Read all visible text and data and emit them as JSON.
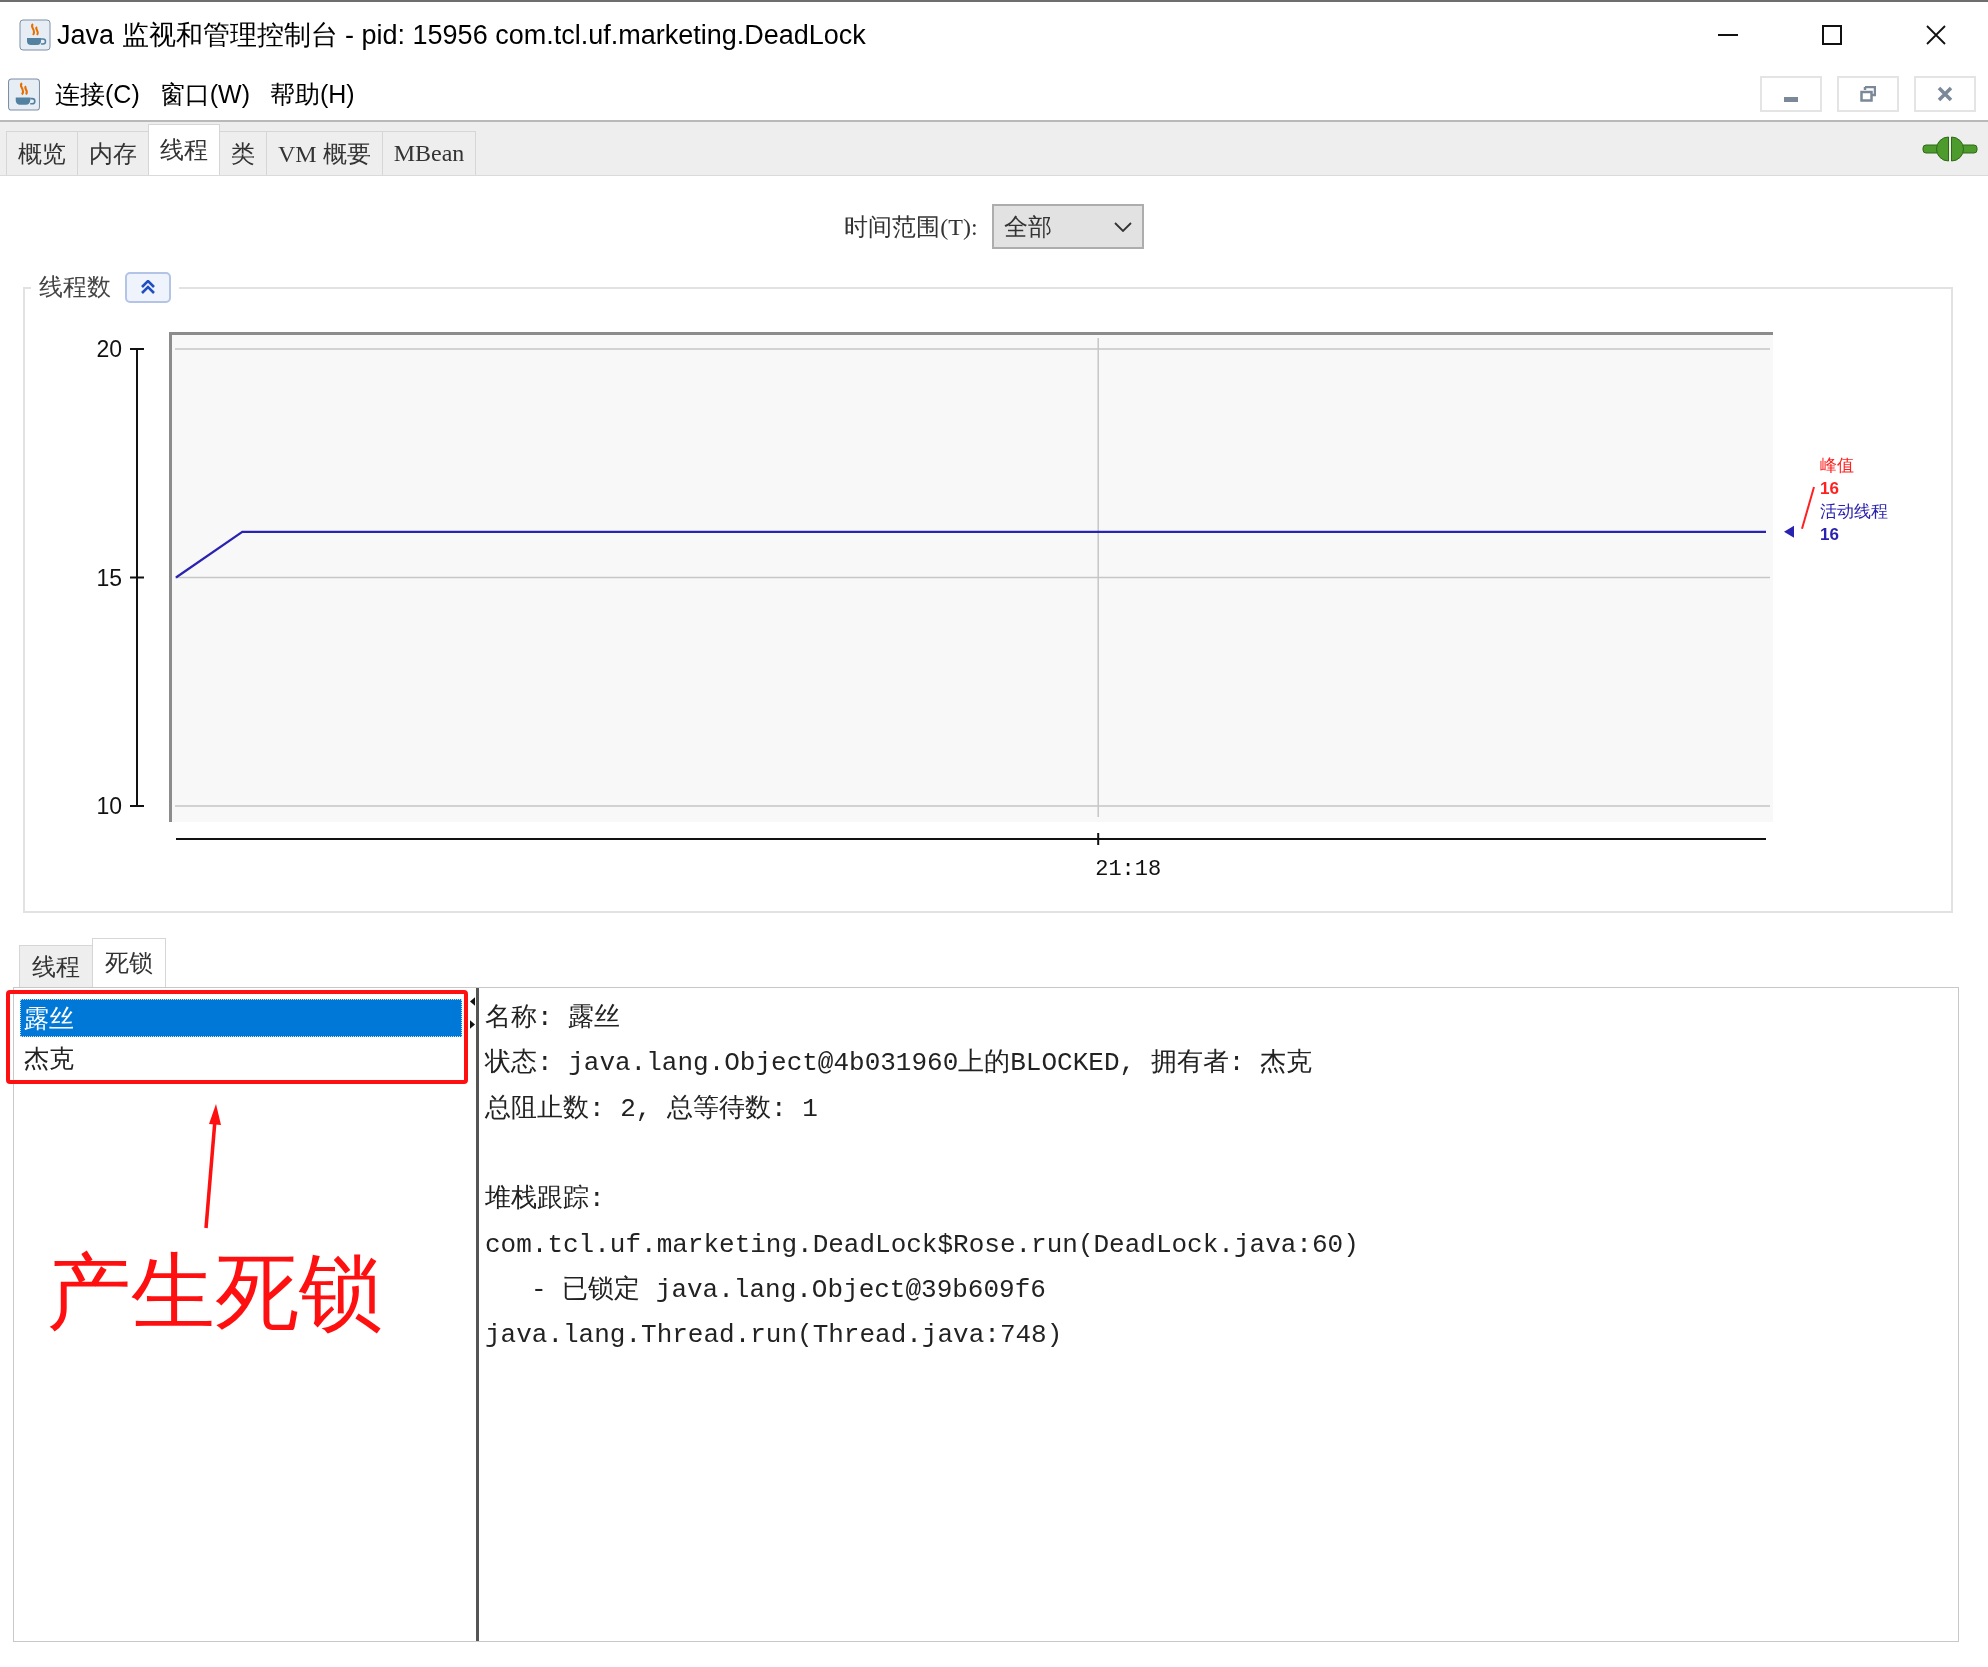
{
  "window": {
    "title": "Java 监视和管理控制台 - pid: 15956 com.tcl.uf.marketing.DeadLock"
  },
  "menu": [
    {
      "label": "连接(C)"
    },
    {
      "label": "窗口(W)"
    },
    {
      "label": "帮助(H)"
    }
  ],
  "tabs": [
    {
      "label": "概览",
      "selected": false
    },
    {
      "label": "内存",
      "selected": false
    },
    {
      "label": "线程",
      "selected": true
    },
    {
      "label": "类",
      "selected": false
    },
    {
      "label": "VM 概要",
      "selected": false
    },
    {
      "label": "MBean",
      "selected": false
    }
  ],
  "time_range": {
    "label": "时间范围(T):",
    "value": "全部"
  },
  "threads_chart": {
    "title": "线程数",
    "expanded": true,
    "peak": {
      "label": "峰值",
      "value": "16",
      "color": "#ff2020"
    },
    "legend_values": [
      "16"
    ],
    "chart_data": {
      "type": "line",
      "ylim": [
        10,
        20
      ],
      "yticks": [
        {
          "value": 10,
          "label": "10"
        },
        {
          "value": 15,
          "label": "15"
        },
        {
          "value": 20,
          "label": "20"
        }
      ],
      "series": [
        {
          "name": "活动线程",
          "color": "#2a22b0",
          "values": [
            15,
            16,
            16,
            16,
            16,
            16,
            16,
            16,
            16,
            16,
            16,
            16,
            16,
            16,
            16,
            16,
            16,
            16,
            16,
            16,
            16,
            16,
            16,
            16,
            16
          ]
        }
      ],
      "annotations": [
        "21:18"
      ]
    }
  },
  "lower_tabs": [
    {
      "label": "线程",
      "selected": false
    },
    {
      "label": "死锁",
      "selected": true
    }
  ],
  "deadlock_list": [
    {
      "name": "露丝",
      "selected": true
    },
    {
      "name": "杰克",
      "selected": false
    }
  ],
  "details": [
    {
      "kind": "info",
      "text": "名称: 露丝"
    },
    {
      "kind": "info",
      "text": "状态: java.lang.Object@4b031960上的BLOCKED, 拥有者: 杰克"
    },
    {
      "kind": "info",
      "text": "总阻止数: 2, 总等待数: 1"
    },
    {
      "kind": "heading",
      "text": "堆栈跟踪:"
    },
    {
      "kind": "frame",
      "text": "com.tcl.uf.marketing.DeadLock$Rose.run(DeadLock.java:60)"
    },
    {
      "kind": "lock",
      "text": "- 已锁定 java.lang.Object@39b609f6"
    },
    {
      "kind": "frame",
      "text": "java.lang.Thread.run(Thread.java:748)"
    }
  ],
  "annotation": {
    "text": "产生死锁"
  }
}
